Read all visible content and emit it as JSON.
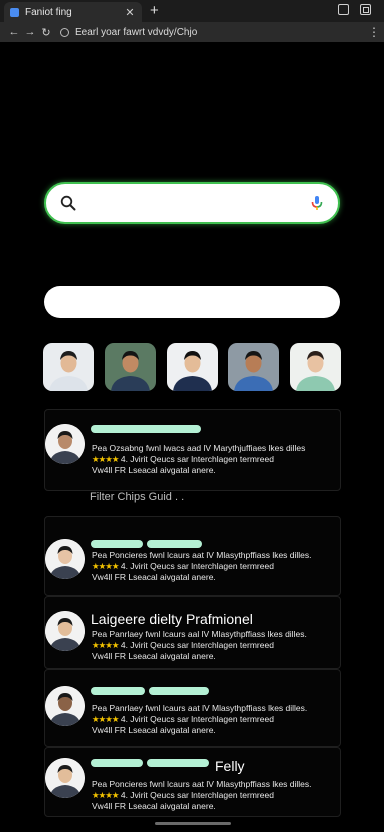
{
  "browser": {
    "tab_title": "Faniot fing",
    "tab_close": "✕",
    "new_tab": "+",
    "url": "Eearl yoar fawrt vdvdy/Chjo",
    "kebab": "⋮"
  },
  "search": {
    "placeholder": "",
    "value": ""
  },
  "pill_input": {
    "placeholder": ""
  },
  "avatars": [
    {
      "name": "person-1",
      "shirt": "#dde3ea",
      "bg": "#e9ecef",
      "skin": "#e2b996",
      "hair": "#1d1d1d"
    },
    {
      "name": "person-2",
      "shirt": "#2a3d58",
      "bg": "#5b7a63",
      "skin": "#c18a63",
      "hair": "#141414"
    },
    {
      "name": "person-3",
      "shirt": "#1f2f4f",
      "bg": "#eef0f2",
      "skin": "#e4bc98",
      "hair": "#111"
    },
    {
      "name": "person-4",
      "shirt": "#3b6db5",
      "bg": "#8e9aa4",
      "skin": "#b77d56",
      "hair": "#151515"
    },
    {
      "name": "person-5",
      "shirt": "#8ec9b0",
      "bg": "#eef1ee",
      "skin": "#e8c2a2",
      "hair": "#2a1f1a"
    }
  ],
  "cards": [
    {
      "heading": "",
      "description_line1": "Pea Ozsabng fwnl lwacs aad lV Marythjuffiaes lkes dilles",
      "stars": "★★★★",
      "description_line2": "4. Jvirit Qeucs sar lnterchlagen termreed",
      "description_line3": "Vw4ll FR Lseacal aivgatal anere.",
      "avatar_tone": "#b88a6a"
    },
    {
      "heading": "",
      "description_line1": "Pea Poncieres fwnl lcaurs aat lV Mlasythpffiass lkes dilles.",
      "stars": "★★★★",
      "description_line2": "4. Jvirit Qeucs sar lnterchlagen termreed",
      "description_line3": "Vw4ll FR Lseacal aivgatal anere.",
      "avatar_tone": "#e6c3a5"
    },
    {
      "heading": "Laigeere dielty Prafmionel",
      "description_line1": "Pea Panrlaey fwnl lcaurs aal lV Mlasythpffiass lkes dilles.",
      "stars": "★★★★",
      "description_line2": "4. Jvirit Qeucs sar lnterchlagen termreed",
      "description_line3": "Vw4ll FR Lseacal aivgatal anere.",
      "avatar_tone": "#e2bd9a"
    },
    {
      "heading": "",
      "description_line1": "Pea Panrlaey fwnl lcaurs aat lV Mlasythpffiass lkes dilles.",
      "stars": "★★★★",
      "description_line2": "4. Jvirit Qeucs sar lnterchlagen termreed",
      "description_line3": "Vw4ll FR Lseacal aivgatal anere.",
      "avatar_tone": "#8a6247"
    },
    {
      "heading": "Felly",
      "description_line1": "Pea Poncieres fwnl lcaurs aat lV Mlasythpffiass lkes dilles.",
      "stars": "★★★★",
      "description_line2": "4. Jvirit Qeucs sar lnterchlagen termreed",
      "description_line3": "Vw4ll FR Lseacal aivgatal anere.",
      "avatar_tone": "#e2bd9a"
    }
  ],
  "separator_label": "Filter Chips Guid . ."
}
